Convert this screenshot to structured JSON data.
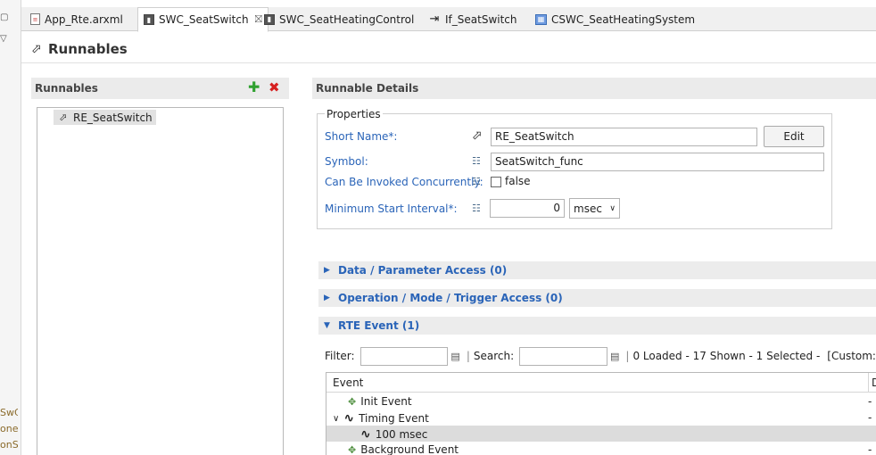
{
  "gutter": {
    "texts": [
      "SwC",
      "one",
      "onS"
    ]
  },
  "tabs": [
    {
      "label": "App_Rte.arxml",
      "icon": "arxml-file-icon"
    },
    {
      "label": "SWC_SeatSwitch",
      "icon": "swc-icon",
      "close": "⛝"
    },
    {
      "label": "SWC_SeatHeatingControl",
      "icon": "swc-icon"
    },
    {
      "label": "If_SeatSwitch",
      "icon": "interface-icon"
    },
    {
      "label": "CSWC_SeatHeatingSystem",
      "icon": "composition-icon"
    }
  ],
  "header": {
    "title": "Runnables",
    "icon": "runnable-icon"
  },
  "runnables": {
    "title": "Runnables",
    "add_label": "✚",
    "remove_label": "✖",
    "items": [
      {
        "label": "RE_SeatSwitch"
      }
    ]
  },
  "details": {
    "title": "Runnable Details",
    "properties_label": "Properties",
    "short_name": {
      "label": "Short Name*:",
      "value": "RE_SeatSwitch",
      "button": "Edit"
    },
    "symbol": {
      "label": "Symbol:",
      "value": "SeatSwitch_func"
    },
    "concurrent": {
      "label": "Can Be Invoked Concurrently:",
      "value": "false"
    },
    "min_interval": {
      "label": "Minimum Start Interval*:",
      "value": "0",
      "unit": "msec"
    }
  },
  "sections": [
    {
      "label": "Data / Parameter Access (0)",
      "expanded": false
    },
    {
      "label": "Operation / Mode / Trigger Access (0)",
      "expanded": false
    },
    {
      "label": "RTE Event (1)",
      "expanded": true
    }
  ],
  "rte_events": {
    "filter_label": "Filter:",
    "search_label": "Search:",
    "status": "0 Loaded - 17 Shown - 1 Selected -",
    "custom": "[Custom:",
    "columns": [
      "Event",
      "D"
    ],
    "rows": [
      {
        "label": "Init Event",
        "value": "-"
      },
      {
        "label": "Timing Event",
        "value": "-"
      },
      {
        "label": "100 msec",
        "value": ""
      },
      {
        "label": "Background Event",
        "value": "-"
      }
    ]
  }
}
